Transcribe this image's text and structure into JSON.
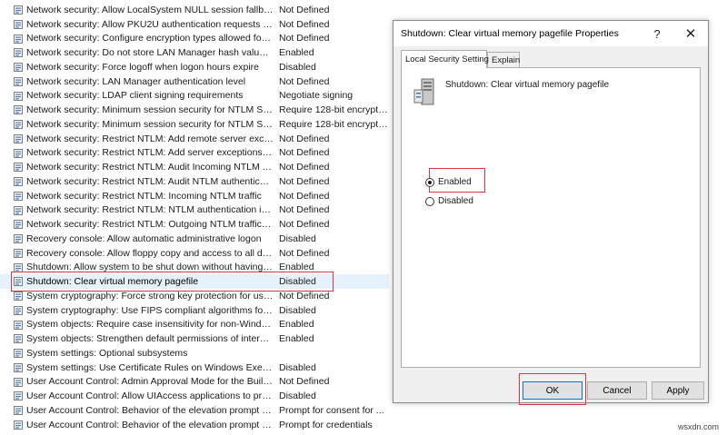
{
  "policies": [
    {
      "name": "Network security: Allow LocalSystem NULL session fallback",
      "setting": "Not Defined"
    },
    {
      "name": "Network security: Allow PKU2U authentication requests to t...",
      "setting": "Not Defined"
    },
    {
      "name": "Network security: Configure encryption types allowed for Ke...",
      "setting": "Not Defined"
    },
    {
      "name": "Network security: Do not store LAN Manager hash value on ...",
      "setting": "Enabled"
    },
    {
      "name": "Network security: Force logoff when logon hours expire",
      "setting": "Disabled"
    },
    {
      "name": "Network security: LAN Manager authentication level",
      "setting": "Not Defined"
    },
    {
      "name": "Network security: LDAP client signing requirements",
      "setting": "Negotiate signing"
    },
    {
      "name": "Network security: Minimum session security for NTLM SSP ...",
      "setting": "Require 128-bit encrypti..."
    },
    {
      "name": "Network security: Minimum session security for NTLM SSP ...",
      "setting": "Require 128-bit encrypti..."
    },
    {
      "name": "Network security: Restrict NTLM: Add remote server excepti...",
      "setting": "Not Defined"
    },
    {
      "name": "Network security: Restrict NTLM: Add server exceptions in t...",
      "setting": "Not Defined"
    },
    {
      "name": "Network security: Restrict NTLM: Audit Incoming NTLM Tra...",
      "setting": "Not Defined"
    },
    {
      "name": "Network security: Restrict NTLM: Audit NTLM authenticatio...",
      "setting": "Not Defined"
    },
    {
      "name": "Network security: Restrict NTLM: Incoming NTLM traffic",
      "setting": "Not Defined"
    },
    {
      "name": "Network security: Restrict NTLM: NTLM authentication in th...",
      "setting": "Not Defined"
    },
    {
      "name": "Network security: Restrict NTLM: Outgoing NTLM traffic to ...",
      "setting": "Not Defined"
    },
    {
      "name": "Recovery console: Allow automatic administrative logon",
      "setting": "Disabled"
    },
    {
      "name": "Recovery console: Allow floppy copy and access to all drives...",
      "setting": "Not Defined"
    },
    {
      "name": "Shutdown: Allow system to be shut down without having to...",
      "setting": "Enabled"
    },
    {
      "name": "Shutdown: Clear virtual memory pagefile",
      "setting": "Disabled"
    },
    {
      "name": "System cryptography: Force strong key protection for user k...",
      "setting": "Not Defined"
    },
    {
      "name": "System cryptography: Use FIPS compliant algorithms for en...",
      "setting": "Disabled"
    },
    {
      "name": "System objects: Require case insensitivity for non-Windows ...",
      "setting": "Enabled"
    },
    {
      "name": "System objects: Strengthen default permissions of internal s...",
      "setting": "Enabled"
    },
    {
      "name": "System settings: Optional subsystems",
      "setting": ""
    },
    {
      "name": "System settings: Use Certificate Rules on Windows Executabl...",
      "setting": "Disabled"
    },
    {
      "name": "User Account Control: Admin Approval Mode for the Built-i...",
      "setting": "Not Defined"
    },
    {
      "name": "User Account Control: Allow UIAccess applications to prom...",
      "setting": "Disabled"
    },
    {
      "name": "User Account Control: Behavior of the elevation prompt for ...",
      "setting": "Prompt for consent for ..."
    },
    {
      "name": "User Account Control: Behavior of the elevation prompt for ...",
      "setting": "Prompt for credentials"
    }
  ],
  "selected_index": 19,
  "dialog": {
    "title": "Shutdown: Clear virtual memory pagefile Properties",
    "help_label": "?",
    "close_label": "✕",
    "tabs": [
      {
        "label": "Local Security Setting",
        "active": true
      },
      {
        "label": "Explain",
        "active": false
      }
    ],
    "policy_name": "Shutdown: Clear virtual memory pagefile",
    "options": {
      "enabled_label": "Enabled",
      "disabled_label": "Disabled",
      "selected": "Enabled"
    },
    "buttons": {
      "ok": "OK",
      "cancel": "Cancel",
      "apply": "Apply"
    }
  },
  "watermark": "wsxdn.com",
  "colors": {
    "highlight": "#d9363e",
    "selection": "#e5f1fb",
    "dialog_bg": "#f0f0f0"
  }
}
